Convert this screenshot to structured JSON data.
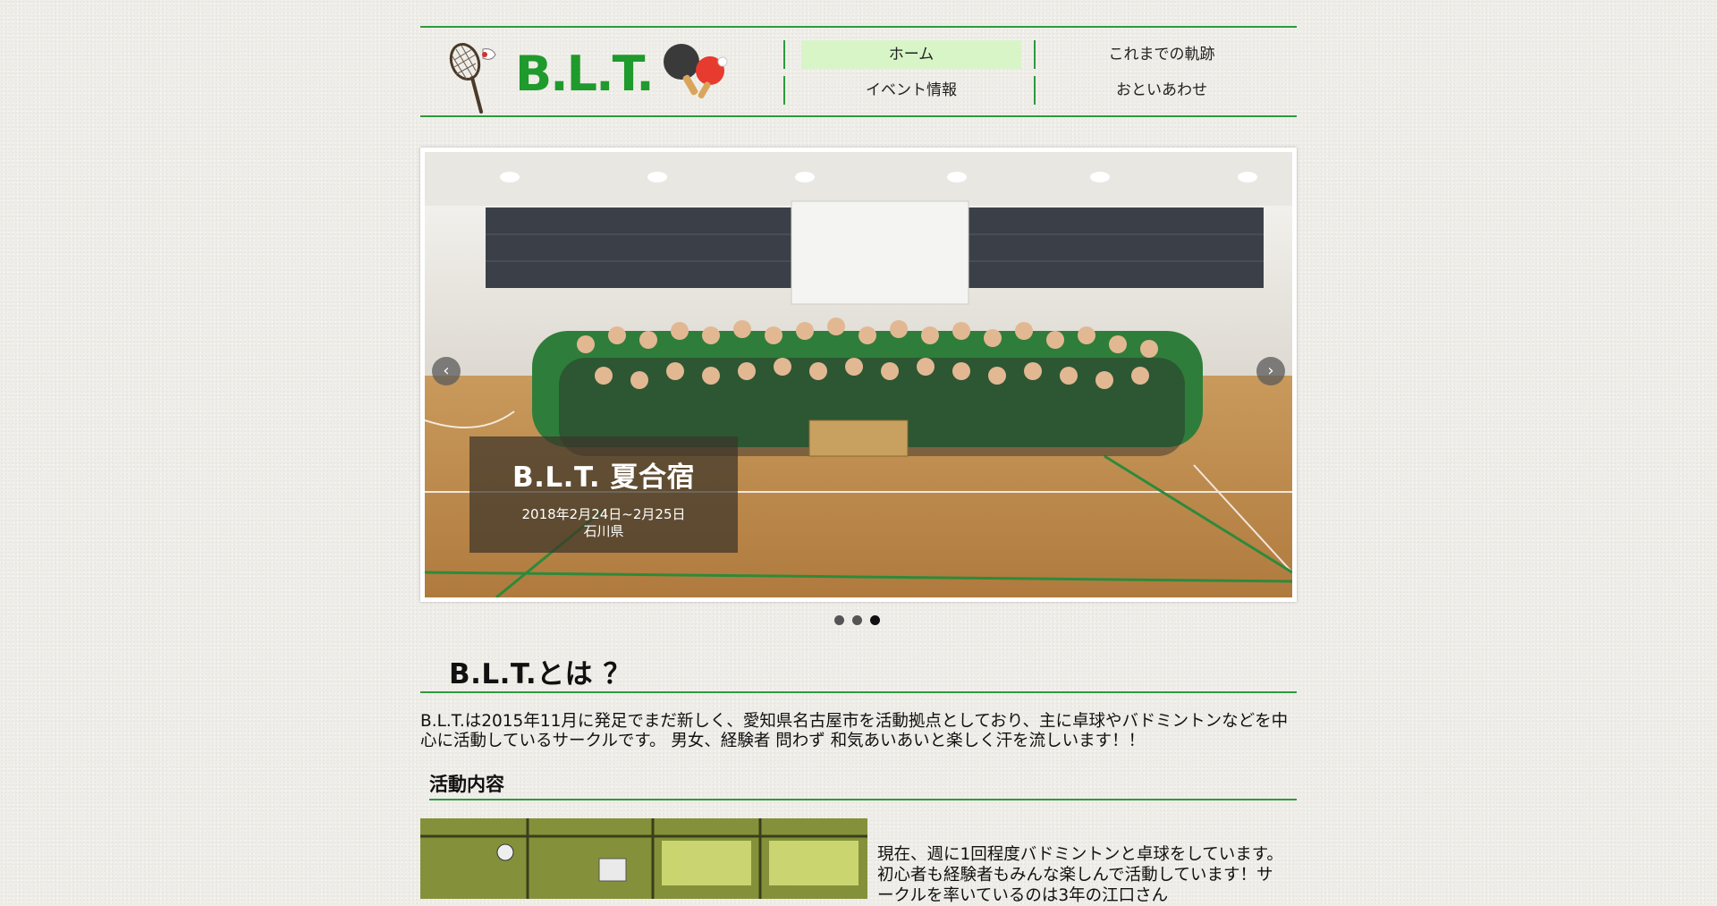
{
  "header": {
    "logo_text": "B.L.T.",
    "nav": [
      {
        "label": "ホーム",
        "active": true
      },
      {
        "label": "これまでの軌跡",
        "active": false
      },
      {
        "label": "イベント情報",
        "active": false
      },
      {
        "label": "おといあわせ",
        "active": false
      }
    ]
  },
  "slider": {
    "caption_title": "B.L.T. 夏合宿",
    "caption_date": "2018年2月24日~2月25日",
    "caption_place": "石川県",
    "prev_label": "‹",
    "next_label": "›",
    "slide_count": 3,
    "active_slide": 3
  },
  "about": {
    "title": "B.L.T.とは ？",
    "text": " B.L.T.は2015年11月に発足でまだ新しく、愛知県名古屋市を活動拠点としており、主に卓球やバドミントンなどを中心に活動しているサークルです。 男女、経験者 問わず 和気あいあいと楽しく汗を流しいます！！",
    "activity_title": "活動内容",
    "activity_text": "現在、週に1回程度バドミントンと卓球をしています。 初心者も経験者もみんな楽しんで活動しています！サークルを率いているのは3年の江口さん"
  },
  "colors": {
    "accent_green": "#2e9a3e",
    "logo_green": "#1f9a2c",
    "nav_active_bg": "#d8f5c8",
    "page_bg": "#efede8"
  },
  "icons": {
    "logo_left": "badminton-racket-icon",
    "logo_right": "ping-pong-paddles-icon",
    "prev": "chevron-left-icon",
    "next": "chevron-right-icon"
  }
}
